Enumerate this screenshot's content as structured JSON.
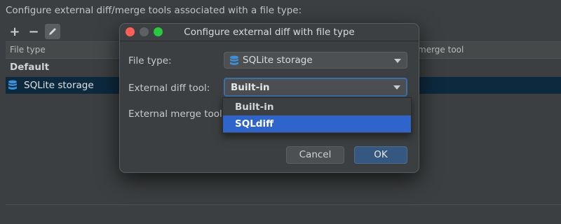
{
  "panel": {
    "heading": "Configure external diff/merge tools associated with a file type:",
    "toolbar": {
      "add": "+",
      "remove": "−",
      "edit_icon": "pencil-icon"
    },
    "columns": {
      "file_type": "File type",
      "merge_tool": "merge tool"
    },
    "group_label": "Default",
    "row": {
      "label": "SQLite storage",
      "icon": "database-icon"
    }
  },
  "dialog": {
    "title": "Configure external diff with file type",
    "file_type_label": "File type:",
    "file_type_value": "SQLite storage",
    "diff_tool_label": "External diff tool:",
    "diff_tool_value": "Built-in",
    "merge_tool_label": "External merge tool:",
    "diff_options": [
      "Built-in",
      "SQLdiff"
    ],
    "selected_option": "SQLdiff",
    "cancel_label": "Cancel",
    "ok_label": "OK"
  },
  "colors": {
    "background": "#3c3f41",
    "selection": "#2f65ca",
    "focus_border": "#3d6fa8",
    "ok_button": "#365880",
    "database_icon": "#3d8fd6"
  }
}
